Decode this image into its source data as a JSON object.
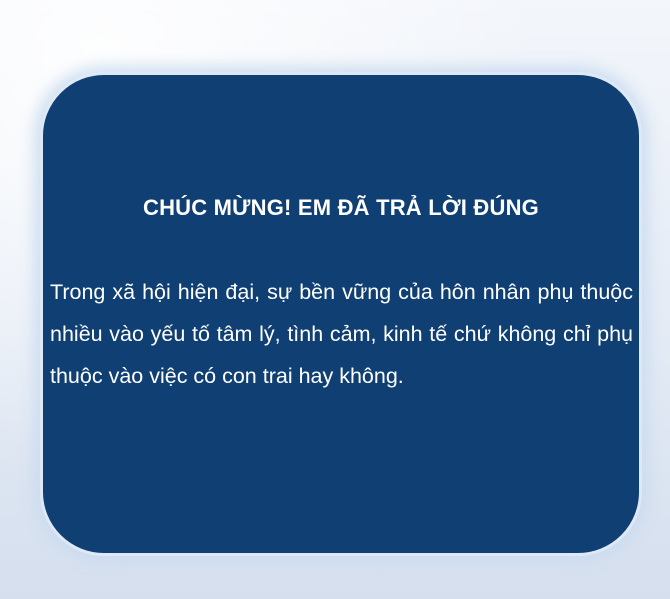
{
  "result_card": {
    "title": "CHÚC MỪNG! EM ĐÃ TRẢ LỜI ĐÚNG",
    "message": "Trong xã hội hiện đại, sự bền vững của hôn nhân phụ thuộc nhiều vào yếu tố tâm lý, tình cảm, kinh tế chứ không chỉ phụ thuộc vào việc có con trai hay không."
  },
  "colors": {
    "card_background": "#0f3f73",
    "card_border": "#dfe9f6",
    "text": "#ffffff",
    "page_background": "#e4ebf5"
  }
}
